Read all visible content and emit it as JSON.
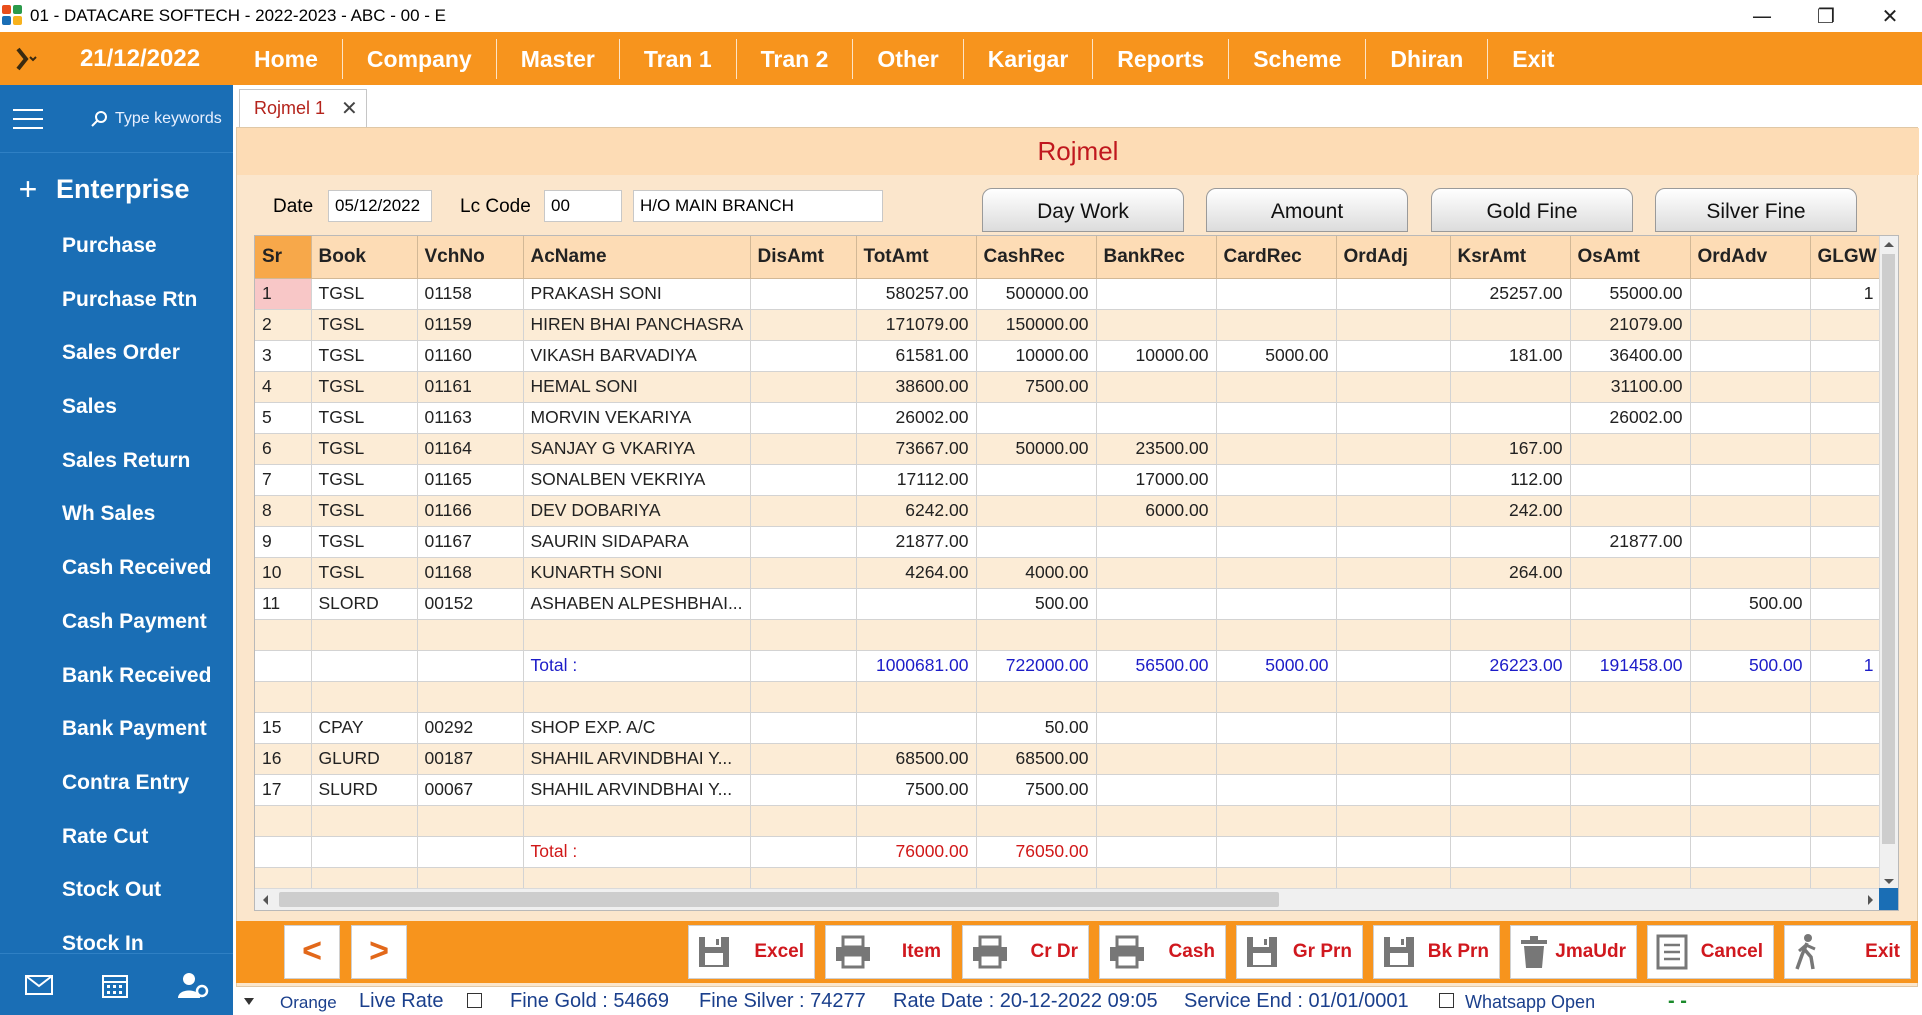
{
  "window": {
    "title": "01 - DATACARE SOFTECH - 2022-2023 - ABC - 00 - E",
    "minimize": "—",
    "restore": "❐",
    "close": "✕"
  },
  "menubar": {
    "date": "21/12/2022",
    "items": [
      "Home",
      "Company",
      "Master",
      "Tran 1",
      "Tran 2",
      "Other",
      "Karigar",
      "Reports",
      "Scheme",
      "Dhiran",
      "Exit"
    ]
  },
  "sidebar": {
    "search_placeholder": "Type keywords",
    "section": "Enterprise",
    "items": [
      "Purchase",
      "Purchase Rtn",
      "Sales Order",
      "Sales",
      "Sales Return",
      "Wh Sales",
      "Cash Received",
      "Cash Payment",
      "Bank Received",
      "Bank Payment",
      "Contra Entry",
      "Rate Cut",
      "Stock Out",
      "Stock In"
    ]
  },
  "tab": {
    "label": "Rojmel 1",
    "close": "✕"
  },
  "panel": {
    "title": "Rojmel",
    "date_label": "Date",
    "date_value": "05/12/2022",
    "lc_label": "Lc Code",
    "lc_value": "00",
    "branch_value": "H/O MAIN BRANCH",
    "buttons": [
      "Day Work",
      "Amount",
      "Gold Fine",
      "Silver Fine"
    ]
  },
  "grid": {
    "columns": [
      "Sr",
      "Book",
      "VchNo",
      "AcName",
      "DisAmt",
      "TotAmt",
      "CashRec",
      "BankRec",
      "CardRec",
      "OrdAdj",
      "KsrAmt",
      "OsAmt",
      "OrdAdv",
      "GLGW"
    ],
    "rows": [
      [
        "1",
        "TGSL",
        "01158",
        "PRAKASH SONI",
        "",
        "580257.00",
        "500000.00",
        "",
        "",
        "",
        "25257.00",
        "55000.00",
        "",
        "1"
      ],
      [
        "2",
        "TGSL",
        "01159",
        "HIREN BHAI PANCHASRA",
        "",
        "171079.00",
        "150000.00",
        "",
        "",
        "",
        "",
        "21079.00",
        "",
        ""
      ],
      [
        "3",
        "TGSL",
        "01160",
        "VIKASH BARVADIYA",
        "",
        "61581.00",
        "10000.00",
        "10000.00",
        "5000.00",
        "",
        "181.00",
        "36400.00",
        "",
        ""
      ],
      [
        "4",
        "TGSL",
        "01161",
        "HEMAL SONI",
        "",
        "38600.00",
        "7500.00",
        "",
        "",
        "",
        "",
        "31100.00",
        "",
        ""
      ],
      [
        "5",
        "TGSL",
        "01163",
        "MORVIN VEKARIYA",
        "",
        "26002.00",
        "",
        "",
        "",
        "",
        "",
        "26002.00",
        "",
        ""
      ],
      [
        "6",
        "TGSL",
        "01164",
        "SANJAY G VKARIYA",
        "",
        "73667.00",
        "50000.00",
        "23500.00",
        "",
        "",
        "167.00",
        "",
        "",
        ""
      ],
      [
        "7",
        "TGSL",
        "01165",
        "SONALBEN VEKRIYA",
        "",
        "17112.00",
        "",
        "17000.00",
        "",
        "",
        "112.00",
        "",
        "",
        ""
      ],
      [
        "8",
        "TGSL",
        "01166",
        "DEV DOBARIYA",
        "",
        "6242.00",
        "",
        "6000.00",
        "",
        "",
        "242.00",
        "",
        "",
        ""
      ],
      [
        "9",
        "TGSL",
        "01167",
        "SAURIN SIDAPARA",
        "",
        "21877.00",
        "",
        "",
        "",
        "",
        "",
        "21877.00",
        "",
        ""
      ],
      [
        "10",
        "TGSL",
        "01168",
        "KUNARTH SONI",
        "",
        "4264.00",
        "4000.00",
        "",
        "",
        "",
        "264.00",
        "",
        "",
        ""
      ],
      [
        "11",
        "SLORD",
        "00152",
        "ASHABEN ALPESHBHAI...",
        "",
        "",
        "500.00",
        "",
        "",
        "",
        "",
        "",
        "500.00",
        ""
      ],
      [
        "",
        "",
        "",
        "",
        "",
        "",
        "",
        "",
        "",
        "",
        "",
        "",
        "",
        ""
      ],
      [
        "",
        "",
        "",
        "Total :",
        "",
        "1000681.00",
        "722000.00",
        "56500.00",
        "5000.00",
        "",
        "26223.00",
        "191458.00",
        "500.00",
        "1"
      ],
      [
        "",
        "",
        "",
        "",
        "",
        "",
        "",
        "",
        "",
        "",
        "",
        "",
        "",
        ""
      ],
      [
        "15",
        "CPAY",
        "00292",
        "SHOP EXP. A/C",
        "",
        "",
        "50.00",
        "",
        "",
        "",
        "",
        "",
        "",
        ""
      ],
      [
        "16",
        "GLURD",
        "00187",
        "SHAHIL ARVINDBHAI Y...",
        "",
        "68500.00",
        "68500.00",
        "",
        "",
        "",
        "",
        "",
        "",
        ""
      ],
      [
        "17",
        "SLURD",
        "00067",
        "SHAHIL ARVINDBHAI Y...",
        "",
        "7500.00",
        "7500.00",
        "",
        "",
        "",
        "",
        "",
        "",
        ""
      ],
      [
        "",
        "",
        "",
        "",
        "",
        "",
        "",
        "",
        "",
        "",
        "",
        "",
        "",
        ""
      ],
      [
        "",
        "",
        "",
        "Total :",
        "",
        "76000.00",
        "76050.00",
        "",
        "",
        "",
        "",
        "",
        "",
        ""
      ],
      [
        "",
        "",
        "",
        "",
        "",
        "",
        "",
        "",
        "",
        "",
        "",
        "",
        "",
        ""
      ]
    ]
  },
  "toolbar": {
    "prev": "<",
    "next": ">",
    "buttons": [
      {
        "label": "Excel",
        "icon": "save-icon"
      },
      {
        "label": "Item",
        "icon": "printer-icon"
      },
      {
        "label": "Cr Dr",
        "icon": "printer-icon"
      },
      {
        "label": "Cash",
        "icon": "printer-icon"
      },
      {
        "label": "Gr Prn",
        "icon": "save-icon"
      },
      {
        "label": "Bk Prn",
        "icon": "save-icon"
      },
      {
        "label": "JmaUdr",
        "icon": "trash-icon"
      },
      {
        "label": "Cancel",
        "icon": "document-icon"
      },
      {
        "label": "Exit",
        "icon": "walking-man-icon"
      }
    ]
  },
  "statusbar": {
    "theme": "Orange",
    "live_rate": "Live Rate",
    "fine_gold": "Fine Gold : 54669",
    "fine_silver": "Fine Silver : 74277",
    "rate_date": "Rate Date : 20-12-2022 09:05",
    "service_end": "Service End :  01/01/0001",
    "whatsapp": "Whatsapp Open",
    "indicator": "- -"
  },
  "colors": {
    "accent": "#f7941d",
    "sidebar": "#1a6eb5",
    "title_red": "#c0181e",
    "total_blue": "#1c1cc8"
  }
}
